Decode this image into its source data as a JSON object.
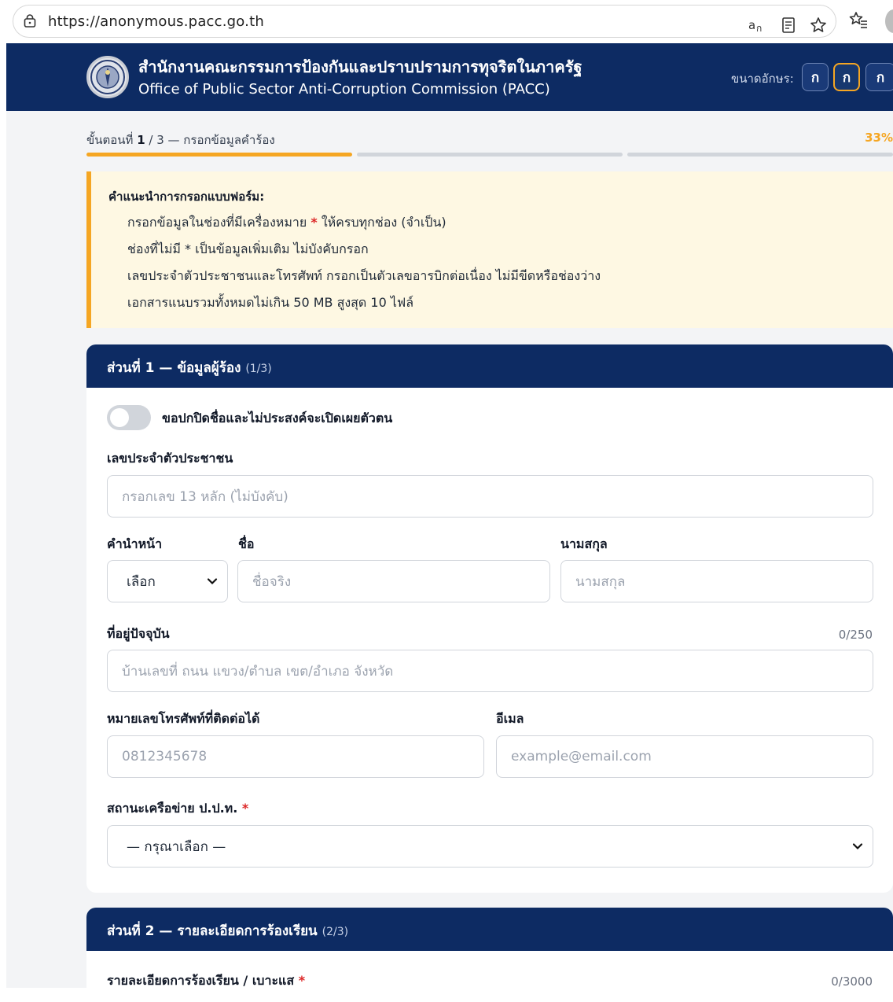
{
  "browser": {
    "url": "https://anonymous.pacc.go.th"
  },
  "header": {
    "title_th": "สำนักงานคณะกรรมการป้องกันและปราบปรามการทุจริตในภาครัฐ",
    "title_en": "Office of Public Sector Anti-Corruption Commission (PACC)",
    "font_size_label": "ขนาดอักษร:",
    "font_size_buttons": [
      "ก",
      "ก",
      "ก"
    ],
    "active_font_button": 1
  },
  "stepper": {
    "label_prefix": "ขั้นตอนที่",
    "current": "1",
    "label_suffix": "/ 3 — กรอกข้อมูลคำร้อง",
    "percent": "33%",
    "segments_total": 3,
    "segments_done": 1
  },
  "instructions": {
    "title": "คำแนะนำการกรอกแบบฟอร์ม:",
    "line1_a": "กรอกข้อมูลในช่องที่มีเครื่องหมาย",
    "line1_star": "*",
    "line1_b": "ให้ครบทุกช่อง (จำเป็น)",
    "line2": "ช่องที่ไม่มี * เป็นข้อมูลเพิ่มเติม ไม่บังคับกรอก",
    "line3": "เลขประจำตัวประชาชนและโทรศัพท์ กรอกเป็นตัวเลขอารบิกต่อเนื่อง ไม่มีขีดหรือช่องว่าง",
    "line4": "เอกสารแนบรวมทั้งหมดไม่เกิน 50 MB สูงสุด 10 ไฟล์"
  },
  "section1": {
    "title": "ส่วนที่ 1 — ข้อมูลผู้ร้อง",
    "step": "(1/3)",
    "anonymous_toggle_label": "ขอปกปิดชื่อและไม่ประสงค์จะเปิดเผยตัวตน",
    "id_label": "เลขประจำตัวประชาชน",
    "id_placeholder": "กรอกเลข 13 หลัก (ไม่บังคับ)",
    "prefix_label": "คำนำหน้า",
    "prefix_value": "เลือก",
    "firstname_label": "ชื่อ",
    "firstname_placeholder": "ชื่อจริง",
    "lastname_label": "นามสกุล",
    "lastname_placeholder": "นามสกุล",
    "address_label": "ที่อยู่ปัจจุบัน",
    "address_counter": "0/250",
    "address_placeholder": "บ้านเลขที่ ถนน แขวง/ตำบล เขต/อำเภอ จังหวัด",
    "phone_label": "หมายเลขโทรศัพท์ที่ติดต่อได้",
    "phone_placeholder": "0812345678",
    "email_label": "อีเมล",
    "email_placeholder": "example@email.com",
    "network_label": "สถานะเครือข่าย ป.ป.ท.",
    "network_star": "*",
    "network_value": "— กรุณาเลือก —"
  },
  "section2": {
    "title": "ส่วนที่ 2 — รายละเอียดการร้องเรียน",
    "step": "(2/3)",
    "detail_label": "รายละเอียดการร้องเรียน / เบาะแส",
    "detail_star": "*",
    "detail_counter": "0/3000"
  },
  "colors": {
    "navy": "#0d2b63",
    "accent": "#f5a623",
    "notice_bg": "#fef8e3",
    "required": "#dc2626"
  },
  "icons": [
    "lock-icon",
    "translate-icon",
    "reader-icon",
    "star-icon",
    "favorites-icon",
    "chevron-down-icon",
    "seal-logo"
  ]
}
